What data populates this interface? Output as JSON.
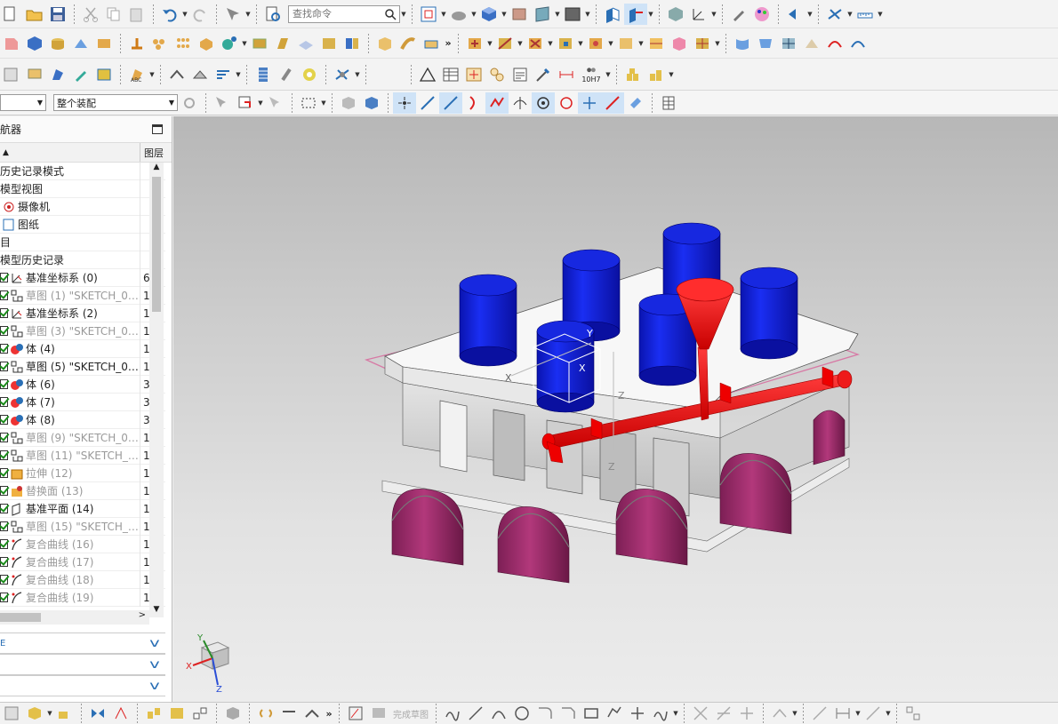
{
  "toolbar": {
    "search_placeholder": "查找命令",
    "row3_tolerance_label": "10H7"
  },
  "selection_bar": {
    "filter_value": "",
    "scope_value": "整个装配"
  },
  "navigator": {
    "title": "航器",
    "col_name": "",
    "col_layer": "图层",
    "items": [
      {
        "label": "历史记录模式",
        "layer": "",
        "dim": false,
        "check": false,
        "icon": "none-icon"
      },
      {
        "label": "模型视图",
        "layer": "",
        "dim": false,
        "check": false,
        "icon": "none-icon"
      },
      {
        "label": "摄像机",
        "layer": "",
        "dim": false,
        "check": false,
        "icon": "camera-icon"
      },
      {
        "label": "图纸",
        "layer": "",
        "dim": false,
        "check": false,
        "icon": "drawing-sheet-icon"
      },
      {
        "label": "目",
        "layer": "",
        "dim": false,
        "check": false,
        "icon": "none-icon"
      },
      {
        "label": "模型历史记录",
        "layer": "",
        "dim": false,
        "check": false,
        "icon": "none-icon"
      },
      {
        "label": "基准坐标系 (0)",
        "layer": "6",
        "dim": false,
        "check": true,
        "icon": "datum-csys-icon"
      },
      {
        "label": "草图 (1) \"SKETCH_0…",
        "layer": "1",
        "dim": true,
        "check": true,
        "icon": "sketch-icon"
      },
      {
        "label": "基准坐标系 (2)",
        "layer": "1",
        "dim": false,
        "check": true,
        "icon": "datum-csys-icon"
      },
      {
        "label": "草图 (3) \"SKETCH_0…",
        "layer": "1",
        "dim": true,
        "check": true,
        "icon": "sketch-icon"
      },
      {
        "label": "体 (4)",
        "layer": "1",
        "dim": false,
        "check": true,
        "icon": "body-icon"
      },
      {
        "label": "草图 (5) \"SKETCH_0…",
        "layer": "1",
        "dim": false,
        "check": true,
        "icon": "sketch-icon"
      },
      {
        "label": "体 (6)",
        "layer": "3",
        "dim": false,
        "check": true,
        "icon": "body-icon"
      },
      {
        "label": "体 (7)",
        "layer": "3",
        "dim": false,
        "check": true,
        "icon": "body-icon"
      },
      {
        "label": "体 (8)",
        "layer": "3",
        "dim": false,
        "check": true,
        "icon": "body-icon"
      },
      {
        "label": "草图 (9) \"SKETCH_0…",
        "layer": "1",
        "dim": true,
        "check": true,
        "icon": "sketch-icon"
      },
      {
        "label": "草图 (11) \"SKETCH_…",
        "layer": "1",
        "dim": true,
        "check": true,
        "icon": "sketch-icon"
      },
      {
        "label": "拉伸 (12)",
        "layer": "1",
        "dim": true,
        "check": true,
        "icon": "extrude-icon"
      },
      {
        "label": "替换面 (13)",
        "layer": "1",
        "dim": true,
        "check": true,
        "icon": "replace-face-icon"
      },
      {
        "label": "基准平面 (14)",
        "layer": "1",
        "dim": false,
        "check": true,
        "icon": "datum-plane-icon"
      },
      {
        "label": "草图 (15) \"SKETCH_…",
        "layer": "1",
        "dim": true,
        "check": true,
        "icon": "sketch-icon"
      },
      {
        "label": "复合曲线 (16)",
        "layer": "1",
        "dim": true,
        "check": true,
        "icon": "composite-curve-icon"
      },
      {
        "label": "复合曲线 (17)",
        "layer": "1",
        "dim": true,
        "check": true,
        "icon": "composite-curve-icon"
      },
      {
        "label": "复合曲线 (18)",
        "layer": "1",
        "dim": true,
        "check": true,
        "icon": "composite-curve-icon"
      },
      {
        "label": "复合曲线 (19)",
        "layer": "1",
        "dim": true,
        "check": true,
        "icon": "composite-curve-icon"
      }
    ]
  },
  "panels": [
    {
      "label": "E"
    },
    {
      "label": ""
    },
    {
      "label": ""
    }
  ],
  "bottom_toolbar": {
    "finish_sketch_label": "完成草图"
  },
  "triad": {
    "x": "X",
    "y": "Y",
    "z": "Z"
  },
  "colors": {
    "accent_blue": "#2a6fb5",
    "cylinder_blue": "#0a1ee0",
    "sprue_red": "#ee0000",
    "cap_magenta": "#a02a6c",
    "body_grey": "#d9d9d9"
  }
}
